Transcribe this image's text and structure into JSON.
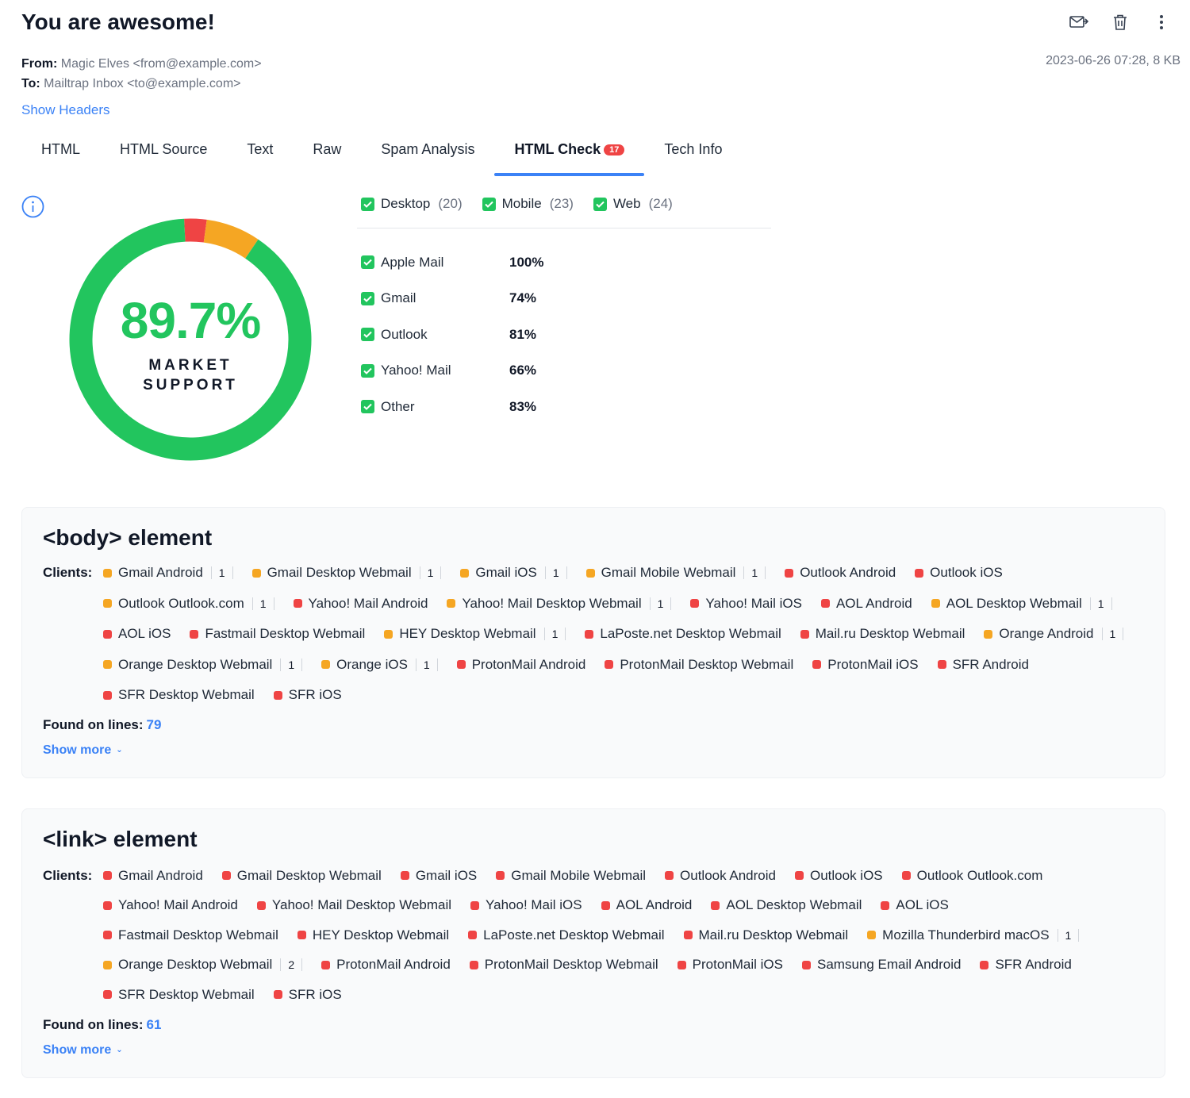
{
  "email": {
    "subject": "You are awesome!",
    "from_label": "From:",
    "from_value": "Magic Elves <from@example.com>",
    "to_label": "To:",
    "to_value": "Mailtrap Inbox <to@example.com>",
    "date_size": "2023-06-26 07:28, 8 KB",
    "show_headers": "Show Headers"
  },
  "actions": [
    {
      "icon": "forward-mail-icon"
    },
    {
      "icon": "trash-icon"
    },
    {
      "icon": "more-vertical-icon"
    }
  ],
  "tabs": [
    {
      "label": "HTML"
    },
    {
      "label": "HTML Source"
    },
    {
      "label": "Text"
    },
    {
      "label": "Raw"
    },
    {
      "label": "Spam Analysis"
    },
    {
      "label": "HTML Check",
      "badge": "17",
      "active": true
    },
    {
      "label": "Tech Info"
    }
  ],
  "market_support": {
    "percent": "89.7%",
    "label_line1": "MARKET",
    "label_line2": "SUPPORT",
    "segments": [
      {
        "color": "#22c55e",
        "fraction": 0.897
      },
      {
        "color": "#ef4444",
        "fraction": 0.03
      },
      {
        "color": "#f5a623",
        "fraction": 0.073
      }
    ]
  },
  "filters": [
    {
      "label": "Desktop",
      "count": "(20)",
      "checked": true
    },
    {
      "label": "Mobile",
      "count": "(23)",
      "checked": true
    },
    {
      "label": "Web",
      "count": "(24)",
      "checked": true
    }
  ],
  "client_support": [
    {
      "name": "Apple Mail",
      "percent": "100%",
      "checked": true
    },
    {
      "name": "Gmail",
      "percent": "74%",
      "checked": true
    },
    {
      "name": "Outlook",
      "percent": "81%",
      "checked": true
    },
    {
      "name": "Yahoo! Mail",
      "percent": "66%",
      "checked": true
    },
    {
      "name": "Other",
      "percent": "83%",
      "checked": true
    }
  ],
  "colors": {
    "accent": "#3b82f6",
    "green": "#22c55e",
    "partial": "#f5a623",
    "unsupported": "#ef4444"
  },
  "cards": [
    {
      "title": "<body> element",
      "clients_label": "Clients:",
      "found_label": "Found on lines:",
      "found_line": "79",
      "show_more": "Show more",
      "clients": [
        {
          "name": "Gmail Android",
          "status": "orange",
          "note": "1"
        },
        {
          "name": "Gmail Desktop Webmail",
          "status": "orange",
          "note": "1"
        },
        {
          "name": "Gmail iOS",
          "status": "orange",
          "note": "1"
        },
        {
          "name": "Gmail Mobile Webmail",
          "status": "orange",
          "note": "1"
        },
        {
          "name": "Outlook Android",
          "status": "red"
        },
        {
          "name": "Outlook iOS",
          "status": "red"
        },
        {
          "name": "Outlook Outlook.com",
          "status": "orange",
          "note": "1"
        },
        {
          "name": "Yahoo! Mail Android",
          "status": "red"
        },
        {
          "name": "Yahoo! Mail Desktop Webmail",
          "status": "orange",
          "note": "1"
        },
        {
          "name": "Yahoo! Mail iOS",
          "status": "red"
        },
        {
          "name": "AOL Android",
          "status": "red"
        },
        {
          "name": "AOL Desktop Webmail",
          "status": "orange",
          "note": "1"
        },
        {
          "name": "AOL iOS",
          "status": "red"
        },
        {
          "name": "Fastmail Desktop Webmail",
          "status": "red"
        },
        {
          "name": "HEY Desktop Webmail",
          "status": "orange",
          "note": "1"
        },
        {
          "name": "LaPoste.net Desktop Webmail",
          "status": "red"
        },
        {
          "name": "Mail.ru Desktop Webmail",
          "status": "red"
        },
        {
          "name": "Orange Android",
          "status": "orange",
          "note": "1"
        },
        {
          "name": "Orange Desktop Webmail",
          "status": "orange",
          "note": "1"
        },
        {
          "name": "Orange iOS",
          "status": "orange",
          "note": "1"
        },
        {
          "name": "ProtonMail Android",
          "status": "red"
        },
        {
          "name": "ProtonMail Desktop Webmail",
          "status": "red"
        },
        {
          "name": "ProtonMail iOS",
          "status": "red"
        },
        {
          "name": "SFR Android",
          "status": "red"
        },
        {
          "name": "SFR Desktop Webmail",
          "status": "red"
        },
        {
          "name": "SFR iOS",
          "status": "red"
        }
      ]
    },
    {
      "title": "<link> element",
      "clients_label": "Clients:",
      "found_label": "Found on lines:",
      "found_line": "61",
      "show_more": "Show more",
      "clients": [
        {
          "name": "Gmail Android",
          "status": "red"
        },
        {
          "name": "Gmail Desktop Webmail",
          "status": "red"
        },
        {
          "name": "Gmail iOS",
          "status": "red"
        },
        {
          "name": "Gmail Mobile Webmail",
          "status": "red"
        },
        {
          "name": "Outlook Android",
          "status": "red"
        },
        {
          "name": "Outlook iOS",
          "status": "red"
        },
        {
          "name": "Outlook Outlook.com",
          "status": "red"
        },
        {
          "name": "Yahoo! Mail Android",
          "status": "red"
        },
        {
          "name": "Yahoo! Mail Desktop Webmail",
          "status": "red"
        },
        {
          "name": "Yahoo! Mail iOS",
          "status": "red"
        },
        {
          "name": "AOL Android",
          "status": "red"
        },
        {
          "name": "AOL Desktop Webmail",
          "status": "red"
        },
        {
          "name": "AOL iOS",
          "status": "red"
        },
        {
          "name": "Fastmail Desktop Webmail",
          "status": "red"
        },
        {
          "name": "HEY Desktop Webmail",
          "status": "red"
        },
        {
          "name": "LaPoste.net Desktop Webmail",
          "status": "red"
        },
        {
          "name": "Mail.ru Desktop Webmail",
          "status": "red"
        },
        {
          "name": "Mozilla Thunderbird macOS",
          "status": "orange",
          "note": "1"
        },
        {
          "name": "Orange Desktop Webmail",
          "status": "orange",
          "note": "2"
        },
        {
          "name": "ProtonMail Android",
          "status": "red"
        },
        {
          "name": "ProtonMail Desktop Webmail",
          "status": "red"
        },
        {
          "name": "ProtonMail iOS",
          "status": "red"
        },
        {
          "name": "Samsung Email Android",
          "status": "red"
        },
        {
          "name": "SFR Android",
          "status": "red"
        },
        {
          "name": "SFR Desktop Webmail",
          "status": "red"
        },
        {
          "name": "SFR iOS",
          "status": "red"
        }
      ]
    }
  ]
}
